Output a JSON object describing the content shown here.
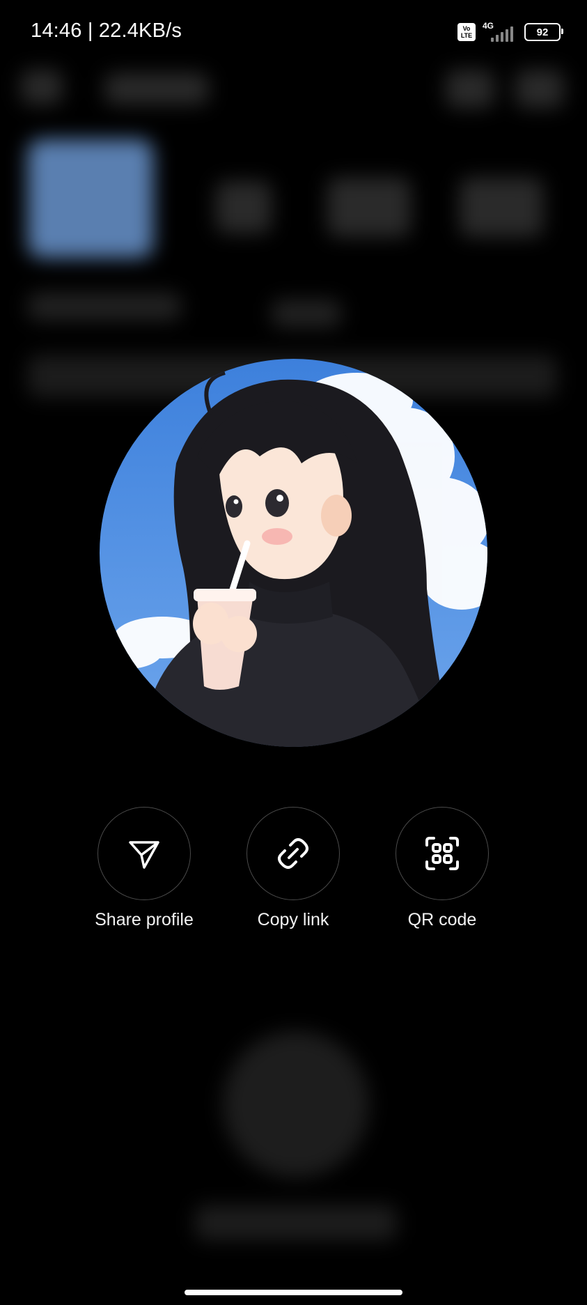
{
  "status_bar": {
    "time_speed": "14:46 | 22.4KB/s",
    "volte_line1": "Vo",
    "volte_line2": "LTE",
    "network": "4G",
    "battery": "92"
  },
  "actions": [
    {
      "label": "Share profile",
      "icon": "send-icon"
    },
    {
      "label": "Copy link",
      "icon": "link-icon"
    },
    {
      "label": "QR code",
      "icon": "qr-code-icon"
    }
  ],
  "colors": {
    "background": "#000000",
    "action_border": "#4a4a4a",
    "text": "#ffffff",
    "sky": "#4f8fe0"
  }
}
